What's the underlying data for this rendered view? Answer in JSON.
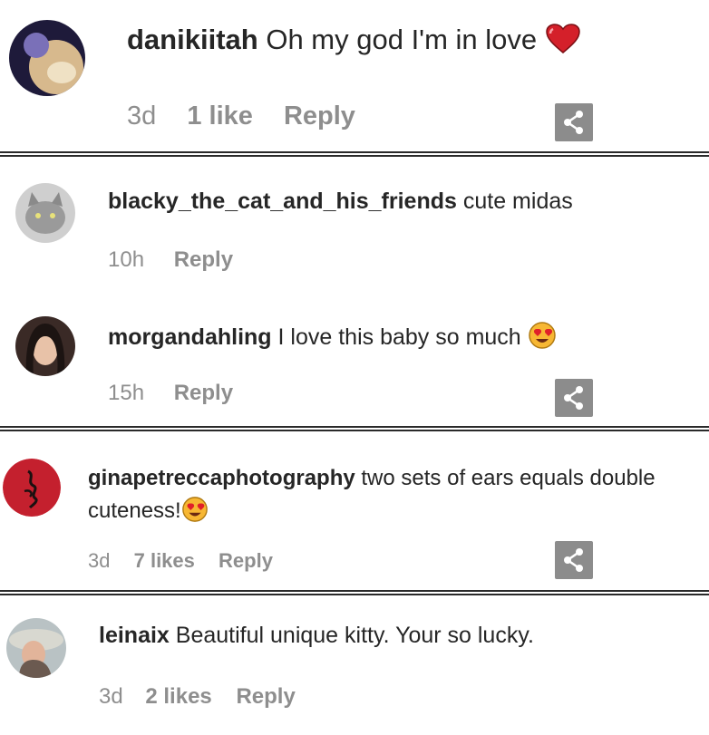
{
  "comments": [
    {
      "username": "danikiitah",
      "text": "Oh my god I'm in love",
      "emoji": "heart-emoji",
      "time": "3d",
      "likes": "1 like",
      "reply": "Reply",
      "has_share": true
    },
    {
      "username": "blacky_the_cat_and_his_friends",
      "text": "cute midas",
      "time": "10h",
      "reply": "Reply",
      "has_share": false
    },
    {
      "username": "morgandahling",
      "text": "I love this baby so much",
      "emoji": "heart-eyes-emoji",
      "time": "15h",
      "reply": "Reply",
      "has_share": true
    },
    {
      "username": "ginapetreccaphotography",
      "text": "two sets of ears equals double",
      "text_line2": "cuteness!",
      "emoji": "heart-eyes-emoji",
      "time": "3d",
      "likes": "7 likes",
      "reply": "Reply",
      "has_share": true
    },
    {
      "username": "leinaix",
      "text": "Beautiful unique kitty. Your so lucky.",
      "time": "3d",
      "likes": "2 likes",
      "reply": "Reply",
      "has_share": false
    }
  ],
  "colors": {
    "text": "#262626",
    "meta": "#8e8e8e",
    "share_button": "#8c8c8c",
    "heart": "#d4202a",
    "emoji_face": "#f7b733"
  }
}
